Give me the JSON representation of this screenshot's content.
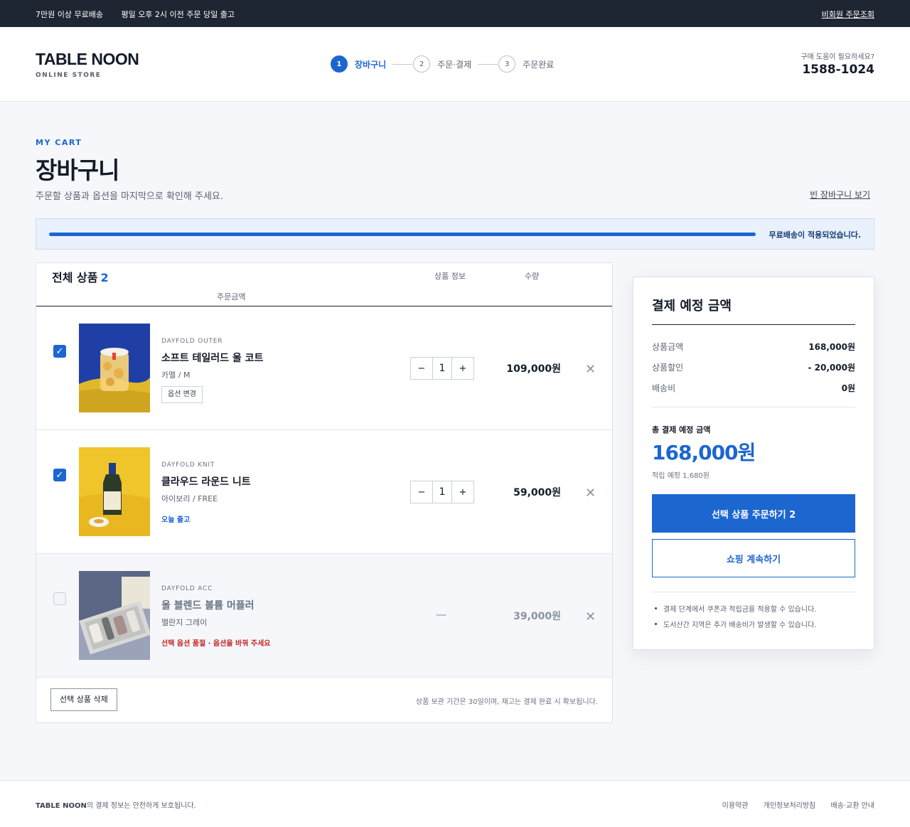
{
  "topbar": {
    "msg1": "7만원 이상 무료배송",
    "msg2": "평일 오후 2시 이전 주문 당일 출고",
    "guest_link": "비회원 주문조회"
  },
  "header": {
    "logo": "TABLE NOON",
    "logo_sub": "ONLINE STORE",
    "steps": [
      {
        "num": "1",
        "label": "장바구니",
        "active": true
      },
      {
        "num": "2",
        "label": "주문·결제",
        "active": false
      },
      {
        "num": "3",
        "label": "주문완료",
        "active": false
      }
    ],
    "help_question": "구매 도움이 필요하세요?",
    "help_phone": "1588-1024"
  },
  "page": {
    "eyebrow": "MY CART",
    "title": "장바구니",
    "description": "주문할 상품과 옵션을 마지막으로 확인해 주세요.",
    "empty_link": "빈 장바구니 보기"
  },
  "shipping_progress": {
    "percent": 100,
    "message": "무료배송이 적용되었습니다."
  },
  "cart": {
    "all_label": "전체 상품",
    "count": "2",
    "col_info": "상품 정보",
    "col_qty": "수량",
    "col_price": "주문금액",
    "items": [
      {
        "checked": true,
        "brand": "DAYFOLD OUTER",
        "name": "소프트 테일러드 울 코트",
        "option": "카멜 / M",
        "action": "옵션 변경",
        "qty": "1",
        "price": "109,000원",
        "image": "jar-on-yellow-cloth"
      },
      {
        "checked": true,
        "brand": "DAYFOLD KNIT",
        "name": "클라우드 라운드 니트",
        "option": "아이보리 / FREE",
        "tag": "오늘 출고",
        "qty": "1",
        "price": "59,000원",
        "image": "bottle-on-yellow"
      },
      {
        "checked": false,
        "brand": "DAYFOLD ACC",
        "name": "울 블렌드 볼륨 머플러",
        "option": "멜란지 그레이",
        "warning": "선택 옵션 품절 · 옵션을 바꿔 주세요",
        "qty_placeholder": "—",
        "price": "39,000원",
        "image": "gift-box-set"
      }
    ],
    "delete_button": "선택 상품 삭제",
    "foot_note": "상품 보관 기간은 30일이며, 재고는 결제 완료 시 확보됩니다."
  },
  "summary": {
    "title": "결제 예정 금액",
    "rows": [
      {
        "label": "상품금액",
        "value": "168,000원"
      },
      {
        "label": "상품할인",
        "value": "- 20,000원"
      },
      {
        "label": "배송비",
        "value": "0원"
      }
    ],
    "total_label": "총 결제 예정 금액",
    "total_amount": "168,000원",
    "points": "적립 예정 1,680원",
    "order_button": "선택 상품 주문하기 2",
    "continue_button": "쇼핑 계속하기",
    "notes": [
      "결제 단계에서 쿠폰과 적립금을 적용할 수 있습니다.",
      "도서산간 지역은 추가 배송비가 발생할 수 있습니다."
    ]
  },
  "footer": {
    "brand": "TABLE NOON",
    "brand_suffix": "의 결제 정보는 안전하게 보호됩니다.",
    "links": [
      "이용약관",
      "개인정보처리방침",
      "배송·교환 안내"
    ]
  },
  "colors": {
    "accent": "#1c66d0",
    "dark": "#1e2633",
    "warning": "#c62828"
  }
}
